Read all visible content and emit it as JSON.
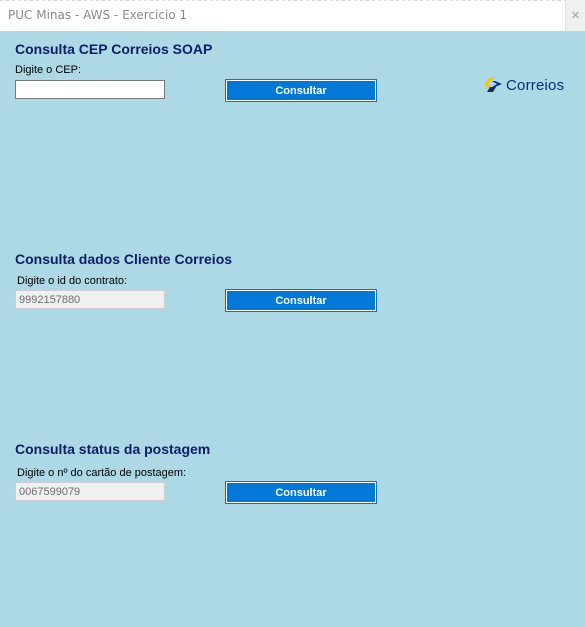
{
  "window": {
    "title": "PUC Minas - AWS - Exercicio 1",
    "close_label": "✕"
  },
  "logo": {
    "text": "Correios"
  },
  "cep_section": {
    "heading": "Consulta CEP Correios SOAP",
    "label": "Digite o CEP:",
    "value": "",
    "button_label": "Consultar"
  },
  "cliente_section": {
    "heading": "Consulta dados Cliente Correios",
    "label": "Digite o id do contrato:",
    "value": "9992157880",
    "button_label": "Consultar"
  },
  "status_section": {
    "heading": "Consulta status da postagem",
    "label": "Digite o nº do cartão de postagem:",
    "value": "0067599079",
    "button_label": "Consultar"
  },
  "colors": {
    "background": "#add8e6",
    "heading": "#0d1d66",
    "button": "#0078d7",
    "logo_yellow": "#f7c400",
    "logo_blue": "#0d2d7a"
  }
}
